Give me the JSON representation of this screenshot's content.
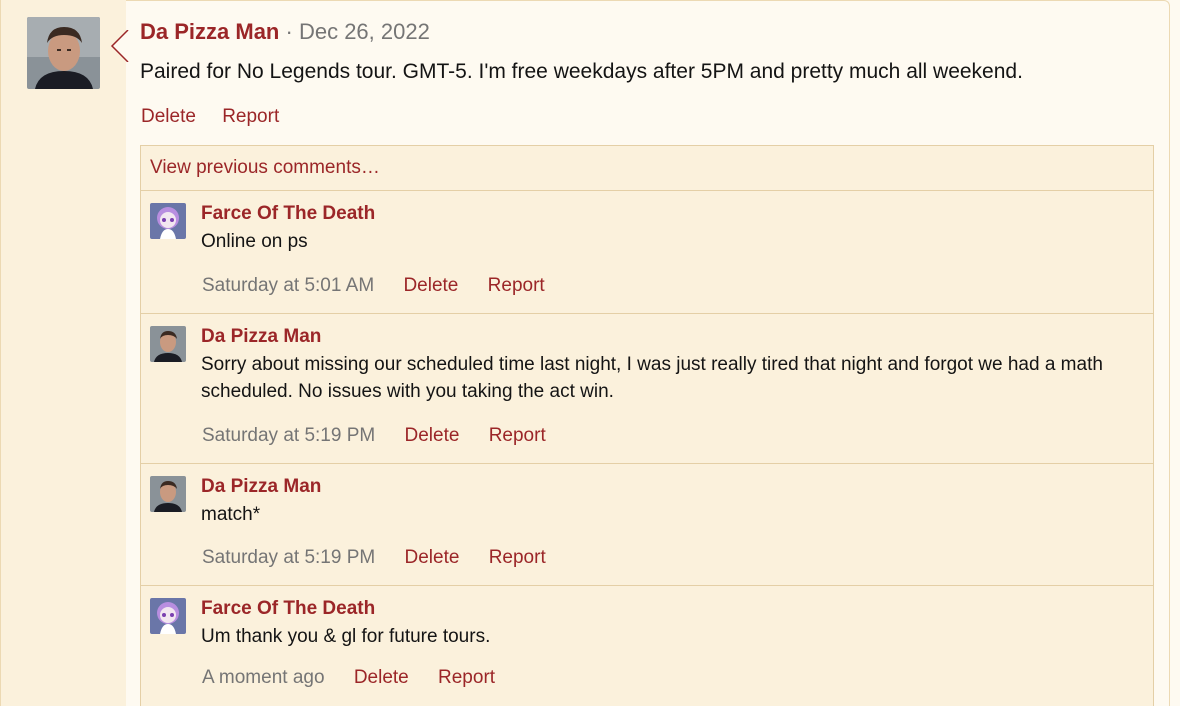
{
  "post": {
    "author": "Da Pizza Man",
    "separator": "·",
    "date": "Dec 26, 2022",
    "body": "Paired for No Legends tour. GMT-5. I'm free weekdays after 5PM and pretty much all weekend.",
    "actions": {
      "delete": "Delete",
      "report": "Report"
    }
  },
  "comments_section": {
    "view_previous": "View previous comments…",
    "comments": [
      {
        "author": "Farce Of The Death",
        "text": "Online on ps",
        "time": "Saturday at 5:01 AM",
        "delete": "Delete",
        "report": "Report",
        "avatar": "anime-avatar"
      },
      {
        "author": "Da Pizza Man",
        "text": "Sorry about missing our scheduled time last night, I was just really tired that night and forgot we had a math scheduled. No issues with you taking the act win.",
        "time": "Saturday at 5:19 PM",
        "delete": "Delete",
        "report": "Report",
        "avatar": "man-avatar"
      },
      {
        "author": "Da Pizza Man",
        "text": "match*",
        "time": "Saturday at 5:19 PM",
        "delete": "Delete",
        "report": "Report",
        "avatar": "man-avatar"
      },
      {
        "author": "Farce Of The Death",
        "text": "Um thank you & gl for future tours.",
        "time": "A moment ago",
        "delete": "Delete",
        "report": "Report",
        "avatar": "anime-avatar"
      }
    ]
  },
  "colors": {
    "accent": "#9b2628",
    "muted": "#757575",
    "background": "#fefaf1",
    "panel": "#fbf1dc",
    "border": "#e4cfa6"
  }
}
